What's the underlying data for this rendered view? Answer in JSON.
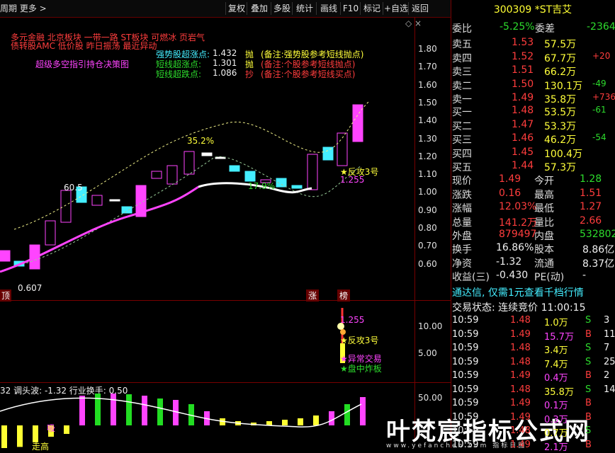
{
  "toolbar": {
    "left": "周期 更多 >",
    "buttons": [
      "复权",
      "叠加",
      "多股",
      "统计",
      "画线",
      "F10",
      "标记",
      "+自选",
      "返回"
    ]
  },
  "main": {
    "notes_top": [
      "多元金融  北京板块  一带一路 ST板块 可燃冰 页岩气",
      "债转股AMC 低价股 昨日振荡 最近异动"
    ],
    "pink_label": "超级多空指引持仓决策图",
    "signals": [
      {
        "label": "强势股超涨点:",
        "value": "1.432",
        "tag": "抛",
        "note": "(备注:强势股参考短线抛点)"
      },
      {
        "label": "短线超涨点:",
        "value": "1.301",
        "tag": "抛",
        "note": "(备注:个股参考短线抛点)"
      },
      {
        "label": "短线超跌点:",
        "value": "1.086",
        "tag": "抄",
        "note": "(备注:个股参考短线买点)"
      }
    ],
    "y_axis": [
      "1.80",
      "1.70",
      "1.60",
      "1.50",
      "1.40",
      "1.30",
      "1.20",
      "1.10",
      "1.00",
      "0.90",
      "0.80",
      "0.70",
      "0.60"
    ],
    "annotations": {
      "pct1": "35.2%",
      "pct2": "60.5",
      "low": "0.607",
      "pct3": "17.9%",
      "fangong": "反攻3号",
      "price": "1.255",
      "zhang": "涨",
      "bang": "榜",
      "edge": "顶"
    }
  },
  "mid": {
    "y_axis": [
      "10.00",
      "5.00"
    ],
    "labels": [
      "1.255",
      "反攻3号",
      "异常交易",
      "盘中炸板"
    ]
  },
  "bottom": {
    "title": "32 调头波: -1.32 行业换手: 0.50",
    "y_axis": [
      "50.00"
    ],
    "labels": [
      "吸",
      "走高"
    ]
  },
  "quote": {
    "code": "300309 *ST吉艾",
    "weibi": {
      "label": "委比",
      "value": "-5.25%",
      "label2": "委差",
      "value2": "-2364"
    },
    "sells": [
      {
        "label": "卖五",
        "price": "1.53",
        "vol": "57.5万",
        "chg": ""
      },
      {
        "label": "卖四",
        "price": "1.52",
        "vol": "67.7万",
        "chg": "+20"
      },
      {
        "label": "卖三",
        "price": "1.51",
        "vol": "66.2万",
        "chg": ""
      },
      {
        "label": "卖二",
        "price": "1.50",
        "vol": "130.1万",
        "chg": "-49"
      },
      {
        "label": "卖一",
        "price": "1.49",
        "vol": "35.8万",
        "chg": "+736"
      }
    ],
    "buys": [
      {
        "label": "买一",
        "price": "1.48",
        "vol": "53.5万",
        "chg": "-61"
      },
      {
        "label": "买二",
        "price": "1.47",
        "vol": "53.3万",
        "chg": ""
      },
      {
        "label": "买三",
        "price": "1.46",
        "vol": "46.2万",
        "chg": "-54"
      },
      {
        "label": "买四",
        "price": "1.45",
        "vol": "100.4万",
        "chg": ""
      },
      {
        "label": "买五",
        "price": "1.44",
        "vol": "57.3万",
        "chg": ""
      }
    ],
    "stats": [
      {
        "l1": "现价",
        "v1": "1.49",
        "l2": "今开",
        "v2": "1.28"
      },
      {
        "l1": "涨跌",
        "v1": "0.16",
        "l2": "最高",
        "v2": "1.51"
      },
      {
        "l1": "涨幅",
        "v1": "12.03%",
        "l2": "最低",
        "v2": "1.27"
      },
      {
        "l1": "总量",
        "v1": "141.2万",
        "l2": "量比",
        "v2": "2.66"
      },
      {
        "l1": "外盘",
        "v1": "879497",
        "l2": "内盘",
        "v2": "532802"
      }
    ],
    "stats2": [
      {
        "l1": "换手",
        "v1": "16.86%",
        "l2": "股本",
        "v2": "8.86亿"
      },
      {
        "l1": "净资",
        "v1": "-1.32",
        "l2": "流通",
        "v2": "8.37亿"
      },
      {
        "l1": "收益(三)",
        "v1": "-0.430",
        "l2": "PE(动)",
        "v2": "-"
      }
    ],
    "ad": "通达信, 仅需1元查看千档行情",
    "status": "交易状态: 连续竞价 11:00:15",
    "trades": [
      {
        "t": "10:59",
        "p": "1.48",
        "v": "1.0万",
        "s": "S",
        "n": "3"
      },
      {
        "t": "10:59",
        "p": "1.49",
        "v": "15.7万",
        "s": "B",
        "n": "11"
      },
      {
        "t": "10:59",
        "p": "1.48",
        "v": "3.4万",
        "s": "S",
        "n": "7"
      },
      {
        "t": "10:59",
        "p": "1.48",
        "v": "7.4万",
        "s": "S",
        "n": "25"
      },
      {
        "t": "10:59",
        "p": "1.49",
        "v": "0.4万",
        "s": "B",
        "n": "2"
      },
      {
        "t": "10:59",
        "p": "1.48",
        "v": "35.8万",
        "s": "S",
        "n": "14"
      },
      {
        "t": "10:59",
        "p": "1.49",
        "v": "0.1万",
        "s": "B",
        "n": ""
      },
      {
        "t": "10:59",
        "p": "1.49",
        "v": "0.3万",
        "s": "B",
        "n": ""
      },
      {
        "t": "10:59",
        "p": "1.48",
        "v": "0.7万",
        "s": "S",
        "n": ""
      },
      {
        "t": "10:59",
        "p": "1.49",
        "v": "2.1万",
        "s": "B",
        "n": ""
      }
    ]
  },
  "watermark": {
    "cn": "叶梵宸指标公式网",
    "en": "www.yefanchen.com  指标日图"
  }
}
